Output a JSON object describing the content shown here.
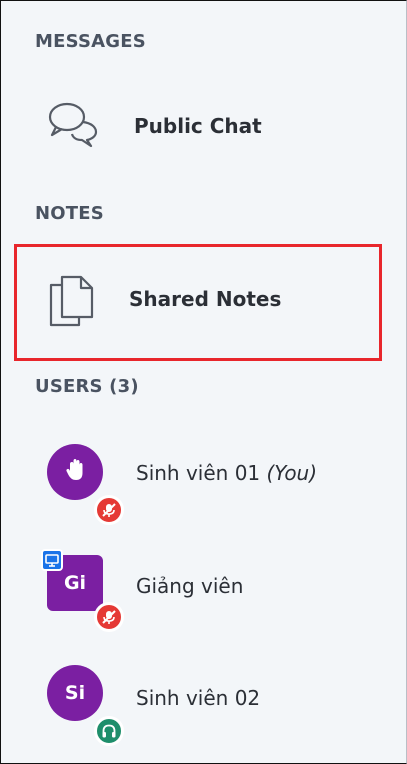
{
  "messages": {
    "title": "MESSAGES",
    "public_chat": {
      "label": "Public Chat",
      "icon": "chat-bubbles-icon"
    }
  },
  "notes": {
    "title": "NOTES",
    "shared_notes": {
      "label": "Shared Notes",
      "icon": "documents-icon",
      "highlight_color": "#e8262c"
    }
  },
  "users": {
    "title": "USERS (3)",
    "list": [
      {
        "avatar_text": "",
        "avatar_icon": "raised-hand-icon",
        "name": "Sinh viên 01",
        "suffix": "(You)",
        "status_icon": "microphone-muted-icon"
      },
      {
        "avatar_text": "Gi",
        "avatar_icon": "presenter-screen-icon",
        "name": "Giảng viên",
        "suffix": "",
        "status_icon": "microphone-muted-icon"
      },
      {
        "avatar_text": "Si",
        "avatar_icon": "",
        "name": "Sinh viên 02",
        "suffix": "",
        "status_icon": "headphones-icon"
      }
    ]
  },
  "colors": {
    "avatar": "#7b1fa2",
    "muted_badge": "#e53935",
    "listen_badge": "#1e8e6b",
    "presenter_badge": "#1a73e8"
  }
}
